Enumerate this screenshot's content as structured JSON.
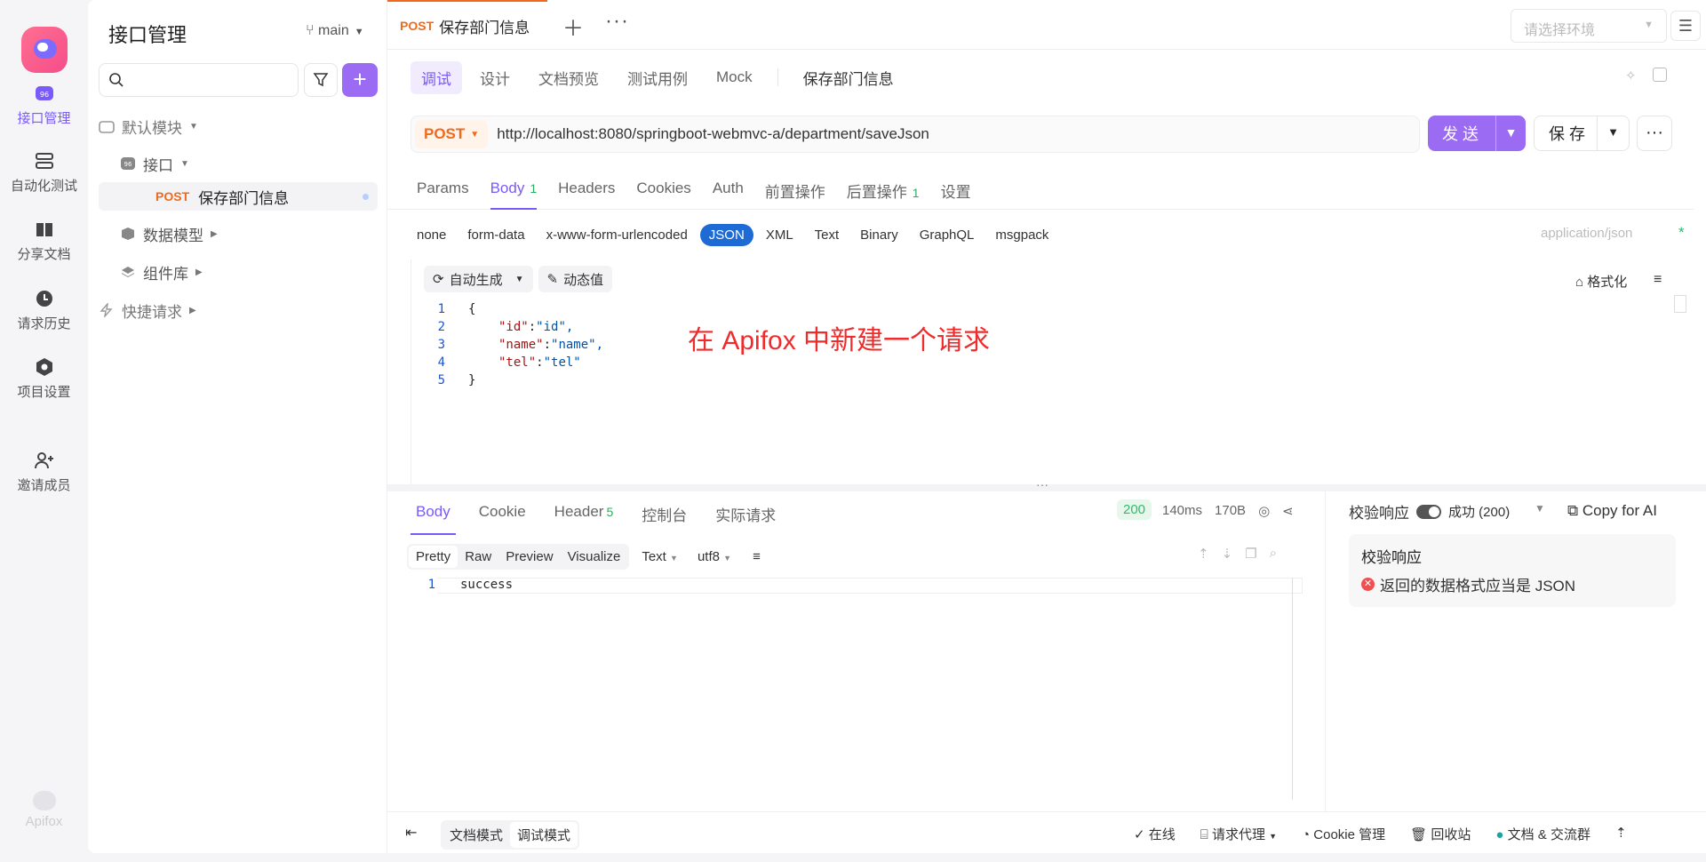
{
  "rail": {
    "items": [
      {
        "label": "接口管理",
        "icon": "api-icon",
        "active": true
      },
      {
        "label": "自动化测试",
        "icon": "automation-icon"
      },
      {
        "label": "分享文档",
        "icon": "book-icon"
      },
      {
        "label": "请求历史",
        "icon": "clock-icon"
      },
      {
        "label": "项目设置",
        "icon": "settings-icon"
      },
      {
        "label": "邀请成员",
        "icon": "add-user-icon"
      }
    ],
    "brand": "Apifox"
  },
  "sidebar": {
    "title": "接口管理",
    "branch": "main",
    "add_label": "+",
    "tree": [
      {
        "label": "默认模块"
      },
      {
        "label": "接口"
      },
      {
        "method": "POST",
        "label": "保存部门信息"
      },
      {
        "label": "数据模型"
      },
      {
        "label": "组件库"
      },
      {
        "label": "快捷请求"
      }
    ]
  },
  "tab": {
    "method": "POST",
    "title": "保存部门信息"
  },
  "env": {
    "placeholder": "请选择环境"
  },
  "subtabs": [
    "调试",
    "设计",
    "文档预览",
    "测试用例",
    "Mock"
  ],
  "subtab_name": "保存部门信息",
  "request": {
    "method": "POST",
    "url": "http://localhost:8080/springboot-webmvc-a/department/saveJson",
    "send_label": "发 送",
    "save_label": "保 存"
  },
  "req_tabs": [
    {
      "label": "Params"
    },
    {
      "label": "Body",
      "badge": "1",
      "active": true
    },
    {
      "label": "Headers"
    },
    {
      "label": "Cookies"
    },
    {
      "label": "Auth"
    },
    {
      "label": "前置操作"
    },
    {
      "label": "后置操作",
      "badge": "1"
    },
    {
      "label": "设置"
    }
  ],
  "body_types": [
    "none",
    "form-data",
    "x-www-form-urlencoded",
    "JSON",
    "XML",
    "Text",
    "Binary",
    "GraphQL",
    "msgpack"
  ],
  "content_type": "application/json",
  "required_mark": "*",
  "editor": {
    "auto_gen": "自动生成",
    "dynamic": "动态值",
    "format": "格式化",
    "lines": [
      "{",
      "\"id\":\"id\",",
      "\"name\":\"name\",",
      "\"tel\":\"tel\"",
      "}"
    ]
  },
  "annotation": "在 Apifox 中新建一个请求",
  "response": {
    "tabs": [
      {
        "label": "Body",
        "active": true
      },
      {
        "label": "Cookie"
      },
      {
        "label": "Header",
        "badge": "5"
      },
      {
        "label": "控制台"
      },
      {
        "label": "实际请求"
      }
    ],
    "status": "200",
    "time": "140ms",
    "size": "170B",
    "views": [
      "Pretty",
      "Raw",
      "Preview",
      "Visualize"
    ],
    "format": "Text",
    "encoding": "utf8",
    "body_line": "success"
  },
  "validate": {
    "label": "校验响应",
    "status": "成功 (200)",
    "copy_ai": "Copy for AI",
    "card_title": "校验响应",
    "error_text": "返回的数据格式应当是 JSON"
  },
  "footer": {
    "modes": [
      "文档模式",
      "调试模式"
    ],
    "online": "在线",
    "proxy": "请求代理",
    "cookie": "Cookie 管理",
    "trash": "回收站",
    "docs": "文档 & 交流群"
  }
}
